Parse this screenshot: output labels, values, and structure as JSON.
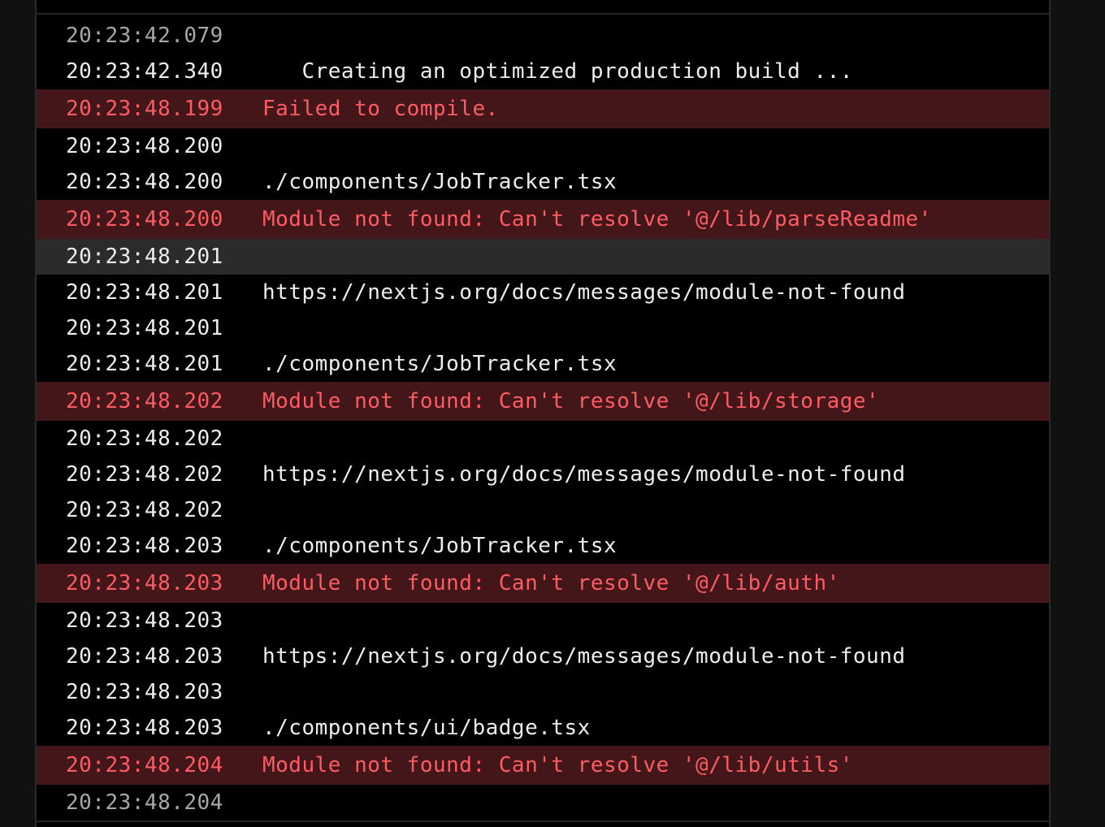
{
  "log": {
    "rows": [
      {
        "time": "20:23:42.079",
        "message": "",
        "level": "info",
        "faded": true
      },
      {
        "time": "20:23:42.340",
        "message": "   Creating an optimized production build ...",
        "level": "info"
      },
      {
        "time": "20:23:48.199",
        "message": "Failed to compile.",
        "level": "error"
      },
      {
        "time": "20:23:48.200",
        "message": "",
        "level": "info"
      },
      {
        "time": "20:23:48.200",
        "message": "./components/JobTracker.tsx",
        "level": "info"
      },
      {
        "time": "20:23:48.200",
        "message": "Module not found: Can't resolve '@/lib/parseReadme'",
        "level": "error"
      },
      {
        "time": "20:23:48.201",
        "message": "",
        "level": "info",
        "highlighted": true
      },
      {
        "time": "20:23:48.201",
        "message": "https://nextjs.org/docs/messages/module-not-found",
        "level": "info"
      },
      {
        "time": "20:23:48.201",
        "message": "",
        "level": "info"
      },
      {
        "time": "20:23:48.201",
        "message": "./components/JobTracker.tsx",
        "level": "info"
      },
      {
        "time": "20:23:48.202",
        "message": "Module not found: Can't resolve '@/lib/storage'",
        "level": "error"
      },
      {
        "time": "20:23:48.202",
        "message": "",
        "level": "info"
      },
      {
        "time": "20:23:48.202",
        "message": "https://nextjs.org/docs/messages/module-not-found",
        "level": "info"
      },
      {
        "time": "20:23:48.202",
        "message": "",
        "level": "info"
      },
      {
        "time": "20:23:48.203",
        "message": "./components/JobTracker.tsx",
        "level": "info"
      },
      {
        "time": "20:23:48.203",
        "message": "Module not found: Can't resolve '@/lib/auth'",
        "level": "error"
      },
      {
        "time": "20:23:48.203",
        "message": "",
        "level": "info"
      },
      {
        "time": "20:23:48.203",
        "message": "https://nextjs.org/docs/messages/module-not-found",
        "level": "info"
      },
      {
        "time": "20:23:48.203",
        "message": "",
        "level": "info"
      },
      {
        "time": "20:23:48.203",
        "message": "./components/ui/badge.tsx",
        "level": "info"
      },
      {
        "time": "20:23:48.204",
        "message": "Module not found: Can't resolve '@/lib/utils'",
        "level": "error"
      },
      {
        "time": "20:23:48.204",
        "message": "",
        "level": "info",
        "faded": true
      }
    ]
  },
  "colors": {
    "background": "#000000",
    "error_background": "#431619",
    "error_text": "#ff5b63",
    "text": "#ededed",
    "highlight_background": "#2b2b2b"
  }
}
